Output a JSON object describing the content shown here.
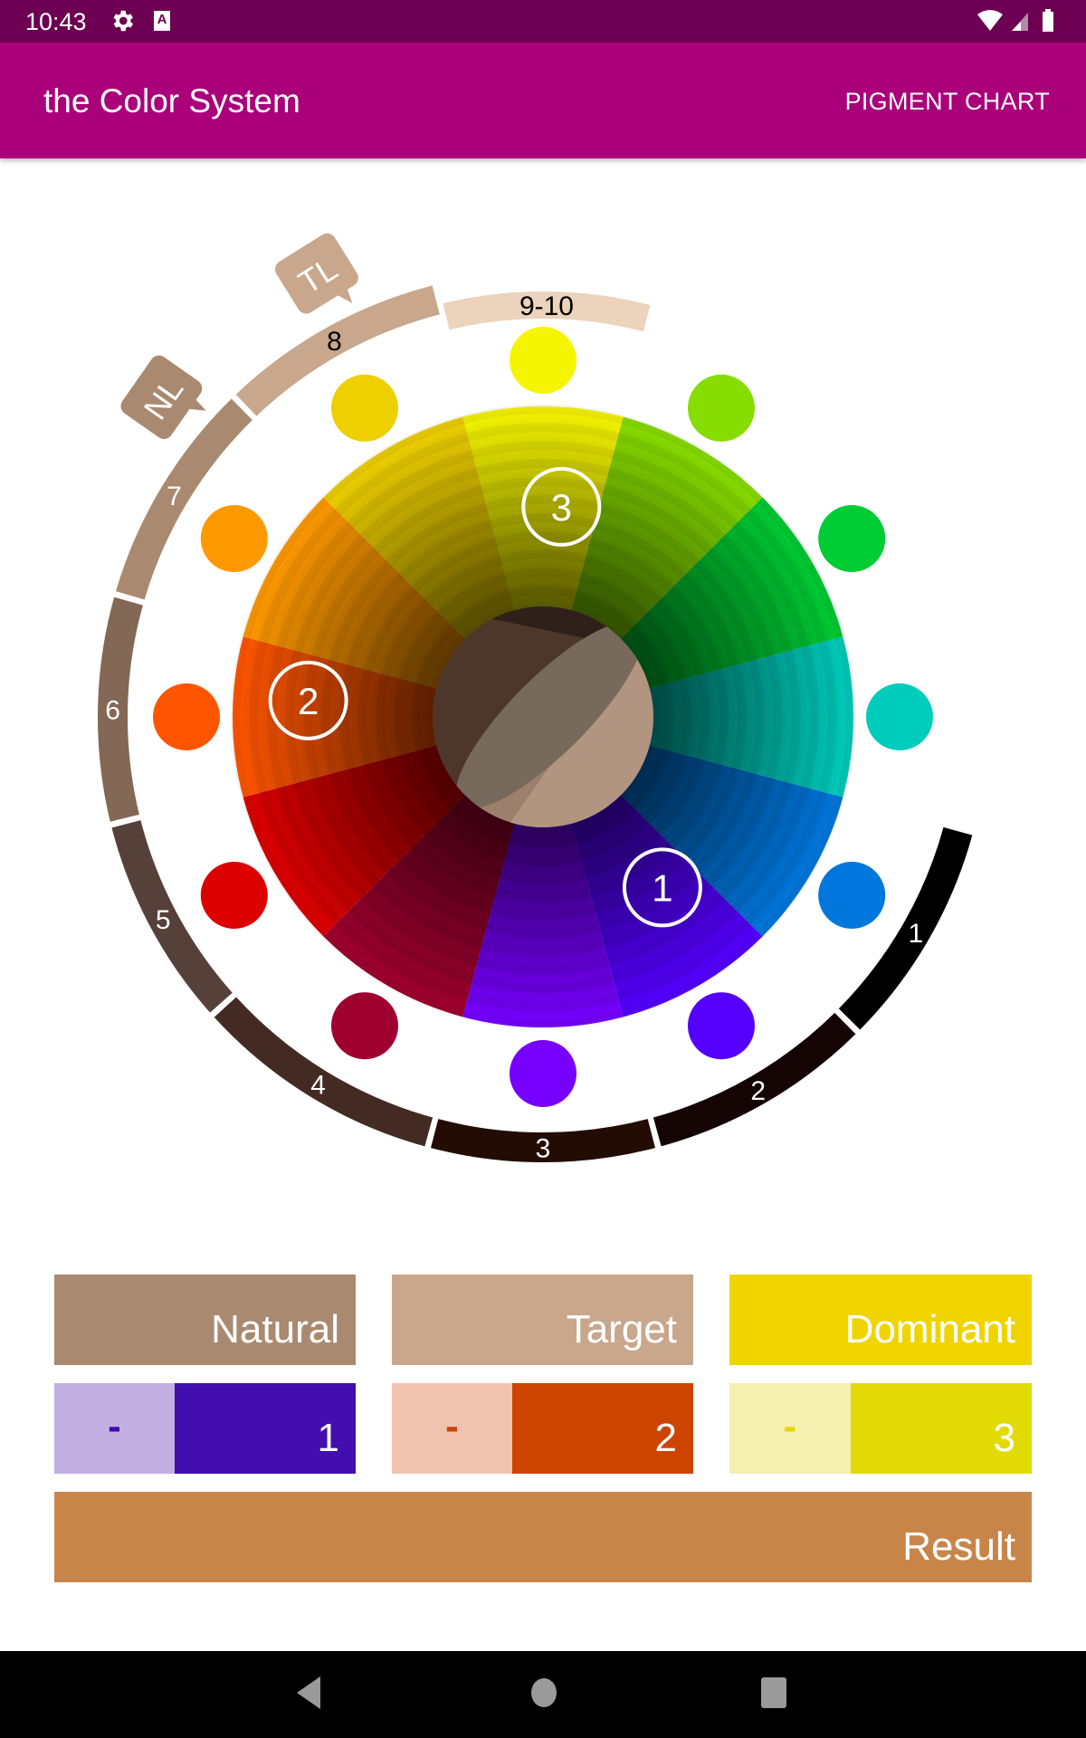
{
  "status_bar": {
    "time": "10:43",
    "icons": [
      "settings-gear-icon",
      "text-a-icon",
      "wifi-icon",
      "cell-signal-icon",
      "battery-icon"
    ]
  },
  "app_bar": {
    "title": "the Color System",
    "action_label": "PIGMENT CHART"
  },
  "wheel": {
    "wedges": [
      {
        "name": "yellow",
        "color": "#f5f500"
      },
      {
        "name": "yellow-green",
        "color": "#88dd00"
      },
      {
        "name": "green",
        "color": "#00cc33"
      },
      {
        "name": "blue-green",
        "color": "#00ccbb"
      },
      {
        "name": "blue",
        "color": "#0077dd"
      },
      {
        "name": "blue-violet",
        "color": "#5500ff"
      },
      {
        "name": "violet",
        "color": "#7700ff"
      },
      {
        "name": "red-violet",
        "color": "#a00030"
      },
      {
        "name": "red",
        "color": "#dd0000"
      },
      {
        "name": "red-orange",
        "color": "#ff5500"
      },
      {
        "name": "orange",
        "color": "#ff9900"
      },
      {
        "name": "yellow-orange",
        "color": "#eed000"
      }
    ],
    "markers": [
      {
        "label": "1",
        "wedge": "blue-violet"
      },
      {
        "label": "2",
        "wedge": "red-orange"
      },
      {
        "label": "3",
        "wedge": "yellow"
      }
    ],
    "levels": [
      {
        "label": "1",
        "color": "#000000",
        "text_color": "#ffffff"
      },
      {
        "label": "2",
        "color": "#140404",
        "text_color": "#ffffff"
      },
      {
        "label": "3",
        "color": "#230c04",
        "text_color": "#ffffff"
      },
      {
        "label": "4",
        "color": "#432b24",
        "text_color": "#ffffff"
      },
      {
        "label": "5",
        "color": "#56413a",
        "text_color": "#ffffff"
      },
      {
        "label": "6",
        "color": "#826855",
        "text_color": "#ffffff"
      },
      {
        "label": "7",
        "color": "#a98a70",
        "text_color": "#ffffff"
      },
      {
        "label": "8",
        "color": "#c8a78c",
        "text_color": "#000000"
      },
      {
        "label": "9-10",
        "color": "#ecd3bc",
        "text_color": "#000000"
      }
    ],
    "tags": [
      {
        "label": "NL",
        "color": "#a98a70"
      },
      {
        "label": "TL",
        "color": "#c8a78c"
      }
    ]
  },
  "panels": {
    "natural": {
      "label": "Natural",
      "color": "#a98a70"
    },
    "target": {
      "label": "Target",
      "color": "#c8a78c"
    },
    "dominant": {
      "label": "Dominant",
      "color": "#f0d400"
    },
    "natural_value": {
      "minus": "-",
      "value": "1",
      "light": "#c2b0e3",
      "color": "#420eaf",
      "minus_color": "#420eaf"
    },
    "target_value": {
      "minus": "-",
      "value": "2",
      "light": "#f0c3b0",
      "color": "#cc4400",
      "minus_color": "#cc4400"
    },
    "dominant_value": {
      "minus": "-",
      "value": "3",
      "light": "#f5f0b0",
      "color": "#e2da06",
      "minus_color": "#e2da06"
    },
    "result": {
      "label": "Result",
      "color": "#c8854a"
    }
  },
  "nav_bar": {
    "buttons": [
      "back-icon",
      "home-icon",
      "recents-icon"
    ]
  }
}
